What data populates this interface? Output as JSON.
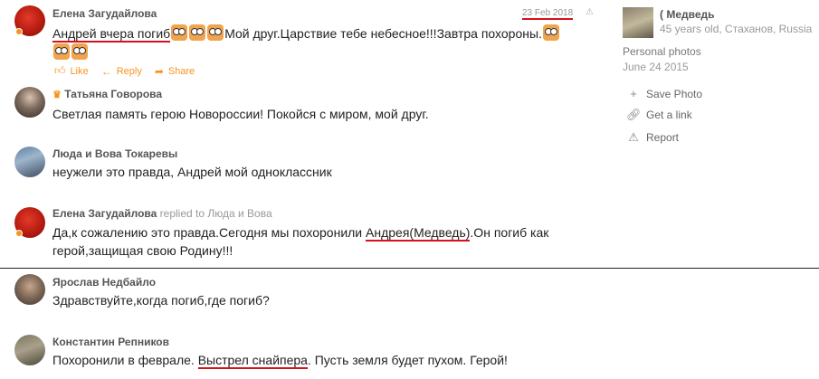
{
  "comments": [
    {
      "author": "Елена Загудайлова",
      "text_underlined": "Андрей вчера погиб",
      "text_rest": "Мой друг.Царствие тебе небесное!!!Завтра похороны.",
      "date": "23 Feb 2018",
      "actions": {
        "like": "Like",
        "reply": "Reply",
        "share": "Share"
      }
    },
    {
      "author": "Татьяна Говорова",
      "text": "Светлая память герою Новороссии! Покойся с миром, мой друг."
    },
    {
      "author": "Люда и Вова Токаревы",
      "text": "неужели это правда, Андрей мой одноклассник"
    },
    {
      "author": "Елена Загудайлова",
      "replied_to": "replied to Люда и Вова",
      "text_before": "Да,к сожалению это правда.Сегодня мы похоронили ",
      "text_underlined": "Андрея(Медведь)",
      "text_after": ".Он погиб как",
      "text_line2": "герой,защищая свою Родину!!!"
    },
    {
      "author": "Ярослав Недбайло",
      "text": "Здравствуйте,когда погиб,где погиб?"
    },
    {
      "author": "Константин Репников",
      "text_before": "Похоронили в феврале. ",
      "text_underlined": "Выстрел снайпера",
      "text_after": ". Пусть земля будет пухом. Герой!"
    }
  ],
  "sidebar": {
    "owner_name": "( Медведь",
    "owner_meta": "45 years old, Стаханов, Russia",
    "album": "Personal photos",
    "album_date": "June 24 2015",
    "links": [
      {
        "label": "Save Photo",
        "icon": "plus-icon"
      },
      {
        "label": "Get a link",
        "icon": "link-icon"
      },
      {
        "label": "Report",
        "icon": "warning-icon"
      }
    ]
  },
  "colors": {
    "accent": "#f7931e",
    "underline": "#d7101a"
  }
}
